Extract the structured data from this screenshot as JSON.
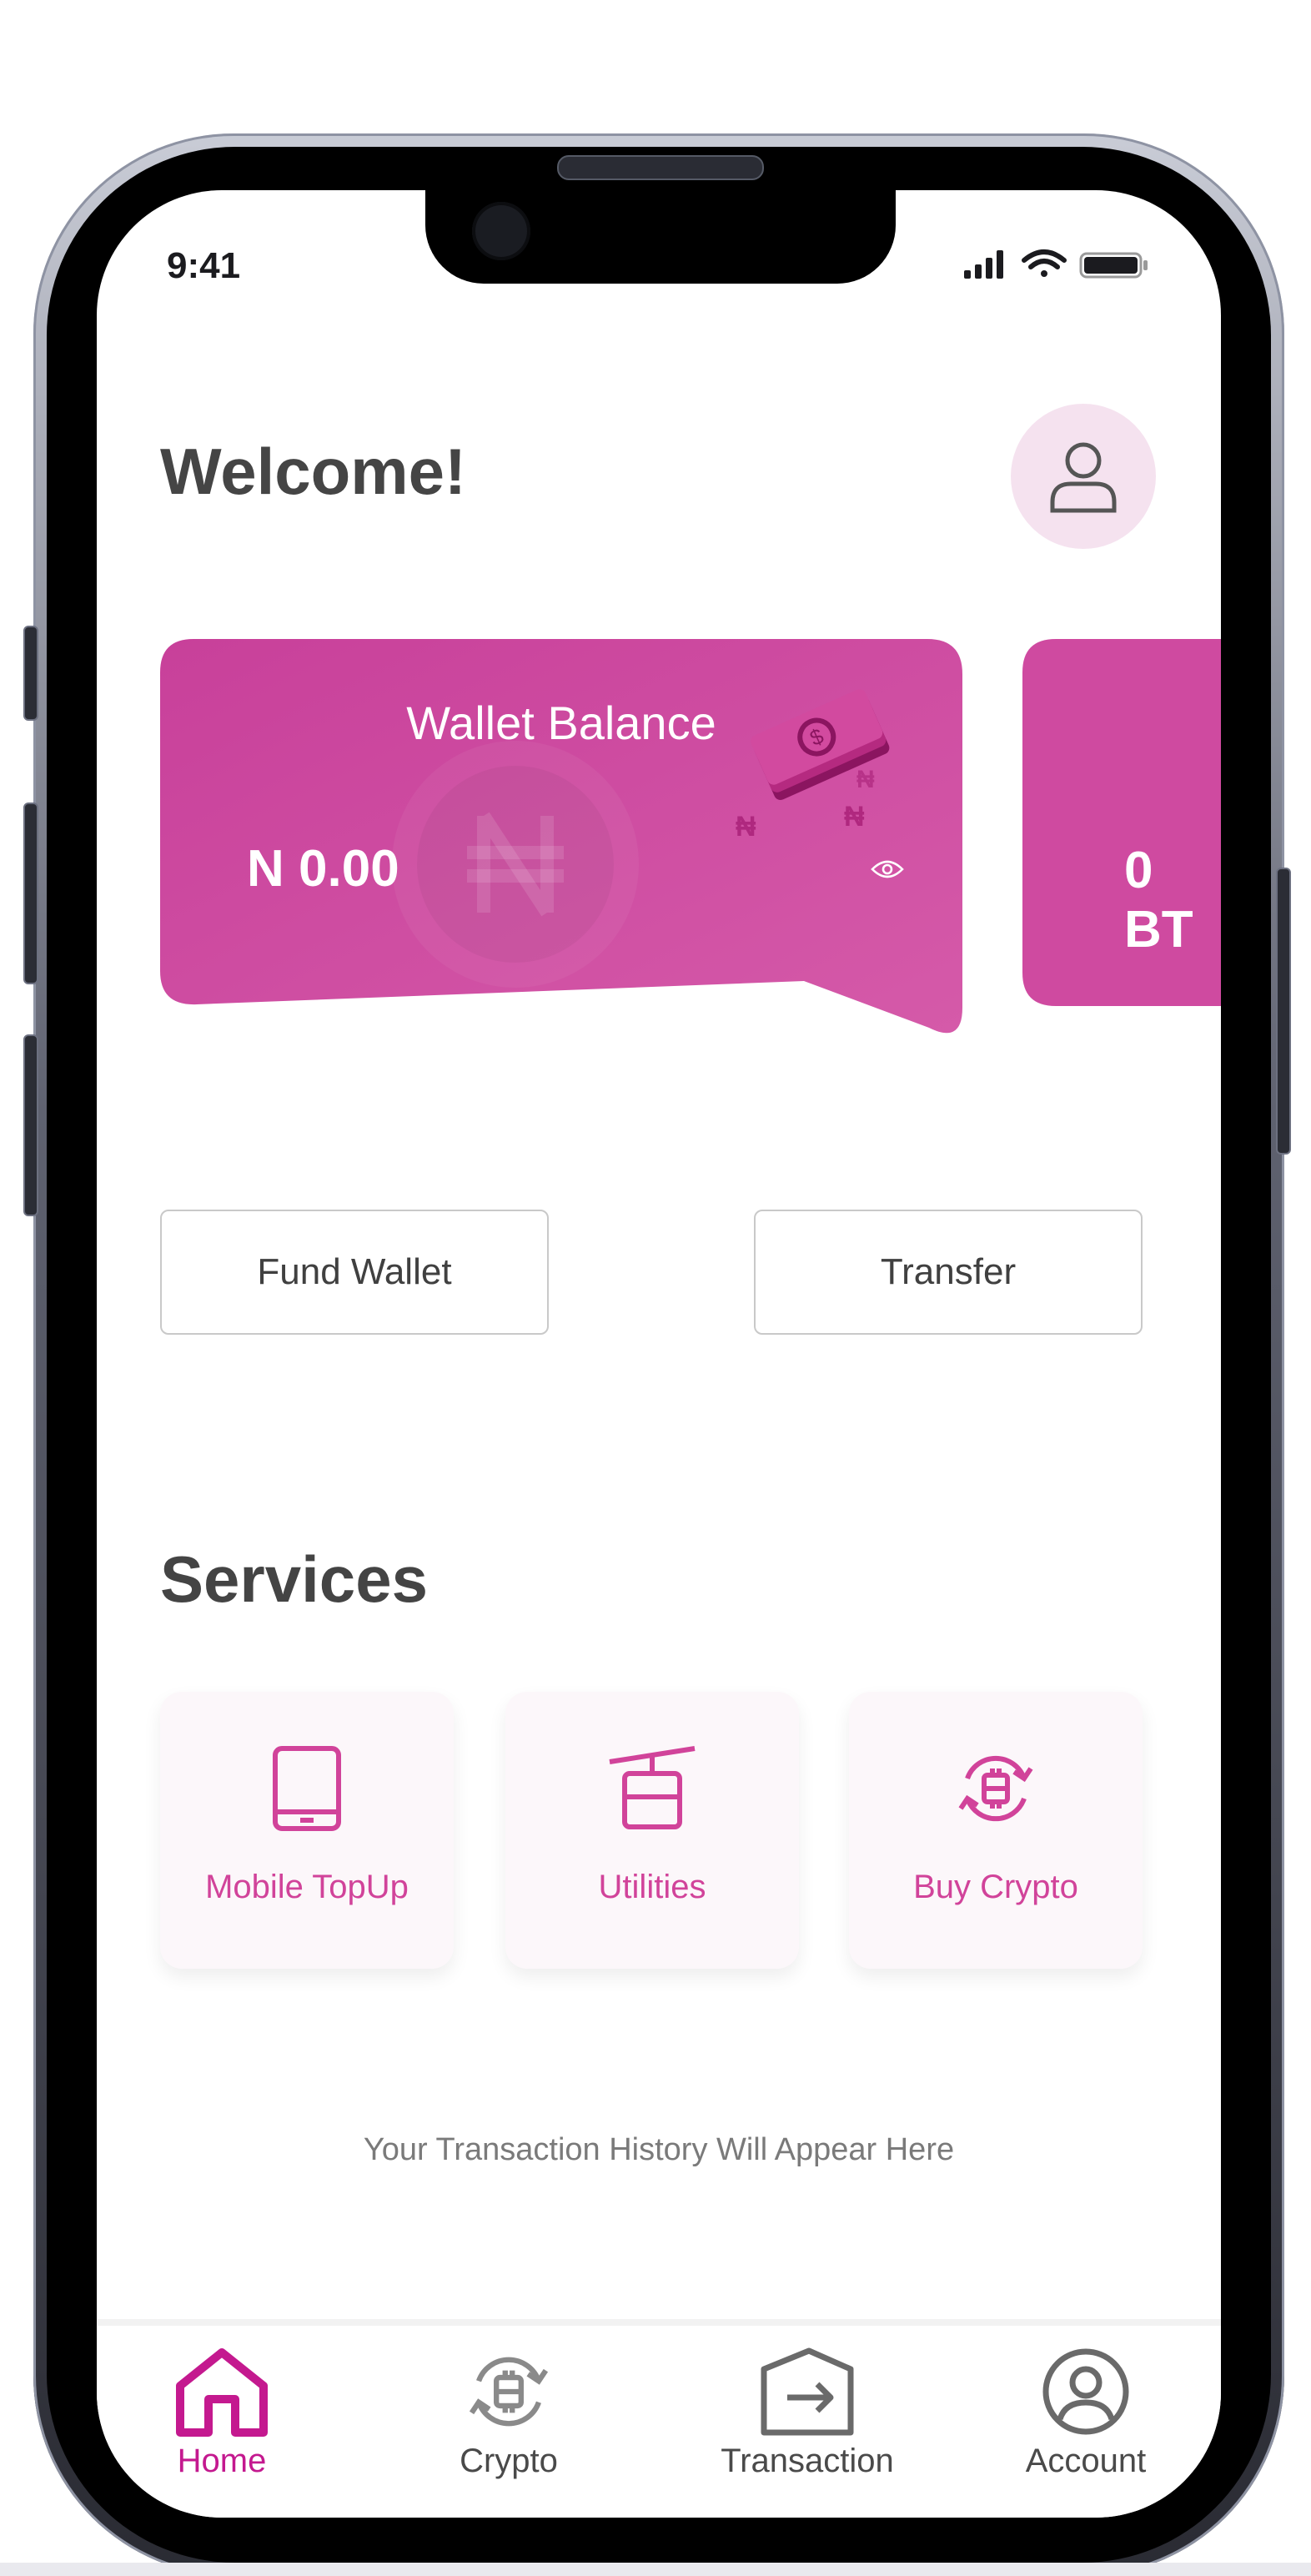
{
  "status_bar": {
    "time": "9:41"
  },
  "header": {
    "welcome": "Welcome!",
    "avatar_icon": "user-icon"
  },
  "wallet_card": {
    "title": "Wallet Balance",
    "amount": "N 0.00",
    "visibility_icon": "eye-icon",
    "illustration_icon": "money-stack-icon"
  },
  "second_card": {
    "amount_partial": "0 BT"
  },
  "actions": {
    "fund_wallet": "Fund Wallet",
    "transfer": "Transfer"
  },
  "services": {
    "title": "Services",
    "items": [
      {
        "label": "Mobile TopUp",
        "icon": "tablet-icon"
      },
      {
        "label": "Utilities",
        "icon": "cable-car-icon"
      },
      {
        "label": "Buy Crypto",
        "icon": "crypto-exchange-icon"
      }
    ]
  },
  "transaction_history": {
    "empty_text": "Your Transaction History Will Appear Here"
  },
  "bottom_nav": {
    "items": [
      {
        "label": "Home",
        "icon": "home-icon",
        "active": true
      },
      {
        "label": "Crypto",
        "icon": "crypto-icon",
        "active": false
      },
      {
        "label": "Transaction",
        "icon": "transaction-icon",
        "active": false
      },
      {
        "label": "Account",
        "icon": "account-icon",
        "active": false
      }
    ]
  },
  "colors": {
    "brand_pink": "#d1439a",
    "card_pink": "#cf4aa0",
    "active_nav": "#c4198f",
    "avatar_bg": "#f5e2ef",
    "text_dark": "#454545"
  }
}
